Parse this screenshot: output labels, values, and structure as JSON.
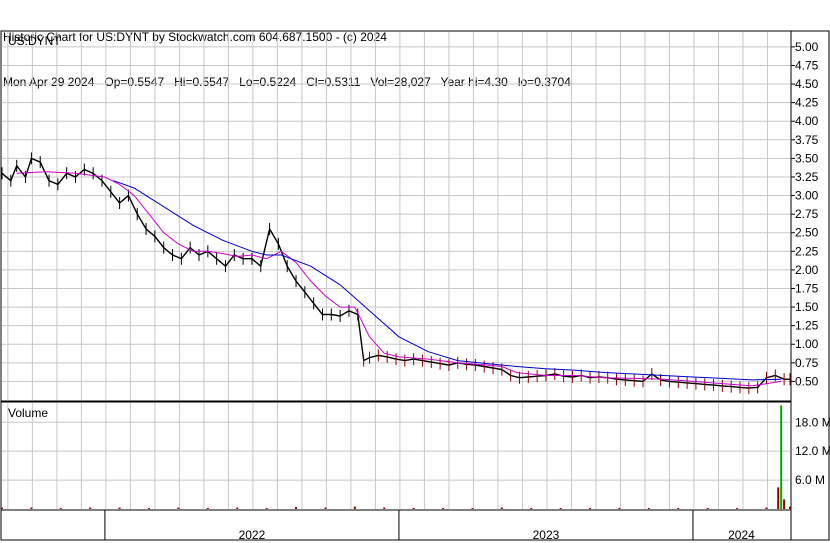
{
  "header": {
    "line1": "Historic Chart for US:DYNT by Stockwatch.com 604.687.1500 - (c) 2024",
    "line2": "Mon Apr 29 2024   Op=0.5547   Hi=0.5547   Lo=0.5224   Cl=0.5311   Vol=28,027   Year hi=4.30   lo=0.3704"
  },
  "colors": {
    "price": "#000000",
    "price_late": "#8b0000",
    "ma_short": "#cc00cc",
    "ma_long": "#0000cc",
    "volume": "#8b0000",
    "volume_spike": "#00aa00",
    "grid": "#c8c8c8"
  },
  "chart_data": [
    {
      "type": "line",
      "title": "US:DYNT",
      "y_ticks": [
        "5.00",
        "4.75",
        "4.50",
        "4.25",
        "4.00",
        "3.75",
        "3.50",
        "3.25",
        "3.00",
        "2.75",
        "2.50",
        "2.25",
        "2.00",
        "1.75",
        "1.50",
        "1.25",
        "1.00",
        "0.75",
        "0.50"
      ],
      "ylim": [
        0.25,
        5.2
      ],
      "x_ticks": [
        "2022",
        "2023",
        "2024"
      ],
      "x_tick_positions": [
        2022.0,
        2023.0,
        2024.0
      ],
      "xlim": [
        2021.65,
        2024.33
      ],
      "grid": true,
      "series": [
        {
          "name": "",
          "style": "price",
          "x": [
            2021.65,
            2021.68,
            2021.7,
            2021.73,
            2021.75,
            2021.78,
            2021.81,
            2021.84,
            2021.87,
            2021.9,
            2021.93,
            2021.96,
            2021.99,
            2022.02,
            2022.05,
            2022.08,
            2022.11,
            2022.14,
            2022.17,
            2022.2,
            2022.23,
            2022.26,
            2022.29,
            2022.32,
            2022.35,
            2022.38,
            2022.41,
            2022.44,
            2022.47,
            2022.5,
            2022.53,
            2022.56,
            2022.59,
            2022.62,
            2022.65,
            2022.68,
            2022.71,
            2022.74,
            2022.77,
            2022.8,
            2022.83,
            2022.86,
            2022.88,
            2022.9,
            2022.93,
            2022.96,
            2022.99,
            2023.02,
            2023.05,
            2023.08,
            2023.11,
            2023.14,
            2023.17,
            2023.2,
            2023.23,
            2023.26,
            2023.29,
            2023.32,
            2023.35,
            2023.38,
            2023.41,
            2023.44,
            2023.47,
            2023.5,
            2023.53,
            2023.56,
            2023.59,
            2023.62,
            2023.65,
            2023.68,
            2023.71,
            2023.74,
            2023.77,
            2023.8,
            2023.83,
            2023.86,
            2023.89,
            2023.92,
            2023.95,
            2023.98,
            2024.01,
            2024.04,
            2024.07,
            2024.1,
            2024.13,
            2024.16,
            2024.19,
            2024.22,
            2024.25,
            2024.28,
            2024.31,
            2024.33
          ],
          "values": [
            3.3,
            3.2,
            3.4,
            3.25,
            3.5,
            3.45,
            3.2,
            3.15,
            3.3,
            3.25,
            3.35,
            3.3,
            3.2,
            3.05,
            2.9,
            3.0,
            2.75,
            2.55,
            2.45,
            2.3,
            2.2,
            2.15,
            2.3,
            2.2,
            2.25,
            2.15,
            2.05,
            2.2,
            2.15,
            2.15,
            2.05,
            2.55,
            2.35,
            2.05,
            1.85,
            1.7,
            1.55,
            1.4,
            1.4,
            1.38,
            1.45,
            1.4,
            0.78,
            0.82,
            0.85,
            0.83,
            0.8,
            0.78,
            0.8,
            0.78,
            0.76,
            0.74,
            0.72,
            0.75,
            0.73,
            0.72,
            0.7,
            0.68,
            0.66,
            0.58,
            0.55,
            0.56,
            0.57,
            0.58,
            0.6,
            0.57,
            0.56,
            0.58,
            0.55,
            0.56,
            0.55,
            0.53,
            0.52,
            0.51,
            0.5,
            0.6,
            0.52,
            0.5,
            0.49,
            0.48,
            0.47,
            0.46,
            0.45,
            0.44,
            0.43,
            0.42,
            0.41,
            0.42,
            0.55,
            0.58,
            0.53,
            0.53
          ]
        },
        {
          "name": "",
          "style": "ma_short",
          "x": [
            2021.7,
            2021.8,
            2021.9,
            2022.0,
            2022.05,
            2022.1,
            2022.15,
            2022.2,
            2022.25,
            2022.3,
            2022.35,
            2022.4,
            2022.45,
            2022.5,
            2022.55,
            2022.6,
            2022.65,
            2022.7,
            2022.75,
            2022.8,
            2022.85,
            2022.9,
            2022.95,
            2023.0,
            2023.1,
            2023.2,
            2023.3,
            2023.35,
            2023.4,
            2023.5,
            2023.6,
            2023.7,
            2023.8,
            2023.9,
            2024.0,
            2024.1,
            2024.2,
            2024.3
          ],
          "values": [
            3.3,
            3.32,
            3.3,
            3.25,
            3.15,
            3.0,
            2.75,
            2.5,
            2.35,
            2.25,
            2.25,
            2.22,
            2.18,
            2.2,
            2.15,
            2.25,
            2.1,
            1.85,
            1.65,
            1.5,
            1.5,
            1.1,
            0.88,
            0.83,
            0.8,
            0.75,
            0.72,
            0.7,
            0.62,
            0.58,
            0.58,
            0.55,
            0.54,
            0.53,
            0.5,
            0.47,
            0.44,
            0.5
          ]
        },
        {
          "name": "",
          "style": "ma_long",
          "x": [
            2022.03,
            2022.1,
            2022.2,
            2022.3,
            2022.4,
            2022.5,
            2022.55,
            2022.6,
            2022.7,
            2022.8,
            2022.9,
            2023.0,
            2023.1,
            2023.2,
            2023.3,
            2023.4,
            2023.5,
            2023.6,
            2023.7,
            2023.8,
            2023.9,
            2024.0,
            2024.1,
            2024.2,
            2024.3
          ],
          "values": [
            3.2,
            3.1,
            2.85,
            2.6,
            2.4,
            2.25,
            2.2,
            2.2,
            2.05,
            1.8,
            1.45,
            1.1,
            0.9,
            0.78,
            0.74,
            0.7,
            0.67,
            0.65,
            0.62,
            0.6,
            0.58,
            0.56,
            0.54,
            0.52,
            0.53
          ]
        }
      ]
    },
    {
      "type": "bar",
      "title": "Volume",
      "y_ticks": [
        "18.0 M",
        "12.0 M",
        "6.0 M"
      ],
      "ylim": [
        0,
        22
      ],
      "x": [
        2021.65,
        2021.75,
        2021.85,
        2021.95,
        2022.05,
        2022.15,
        2022.25,
        2022.35,
        2022.45,
        2022.55,
        2022.65,
        2022.75,
        2022.85,
        2022.95,
        2023.05,
        2023.15,
        2023.25,
        2023.35,
        2023.45,
        2023.55,
        2023.65,
        2023.75,
        2023.85,
        2023.95,
        2024.05,
        2024.15,
        2024.25,
        2024.29,
        2024.3,
        2024.31,
        2024.33
      ],
      "values": [
        0.3,
        0.3,
        0.2,
        0.3,
        0.3,
        0.2,
        0.3,
        0.2,
        0.3,
        0.2,
        0.4,
        0.3,
        0.5,
        0.3,
        0.2,
        0.2,
        0.2,
        0.3,
        0.2,
        0.2,
        0.2,
        0.2,
        0.2,
        0.2,
        0.2,
        0.2,
        0.3,
        4.5,
        21.5,
        2.0,
        0.5
      ],
      "spike_threshold": 5
    }
  ]
}
